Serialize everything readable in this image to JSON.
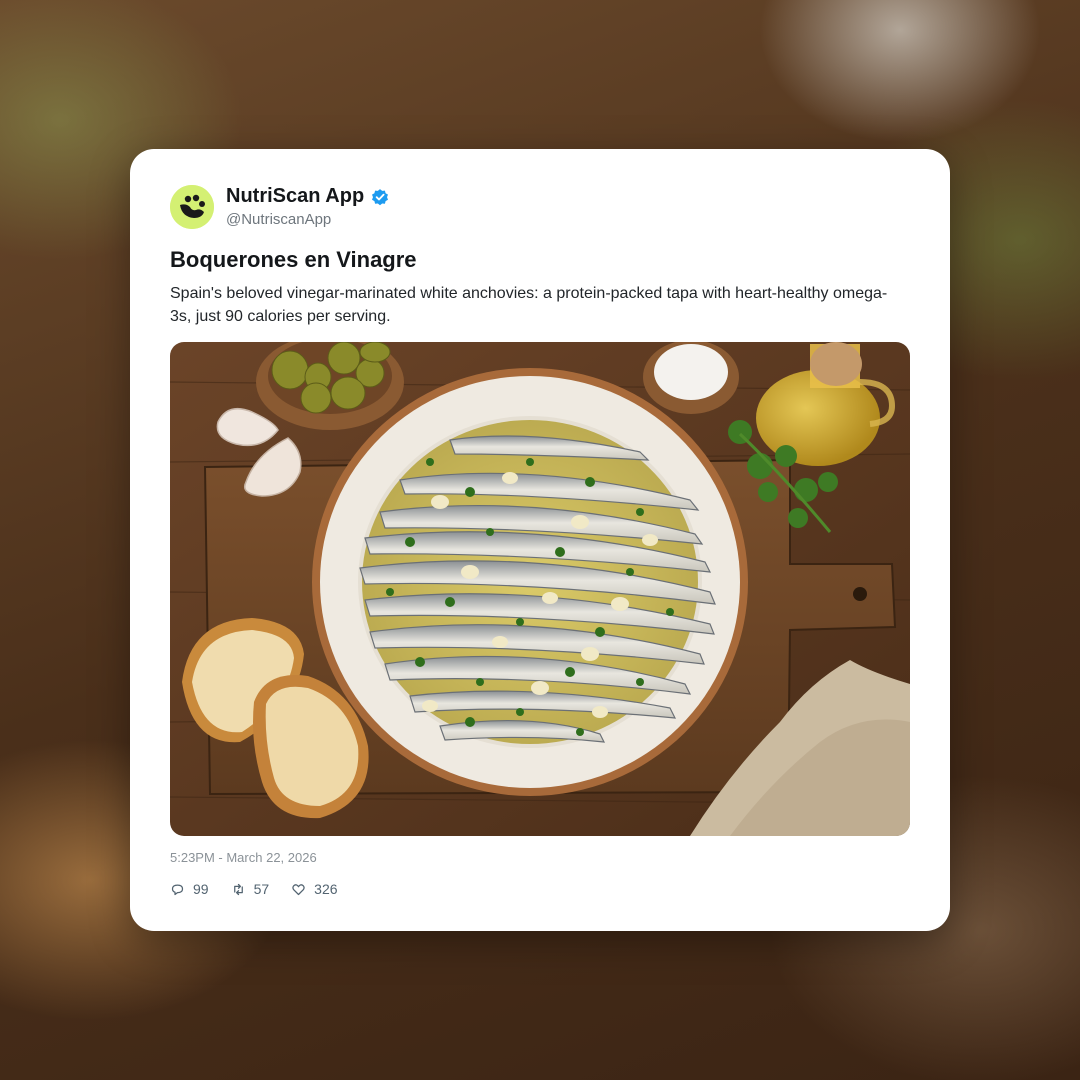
{
  "post": {
    "author": {
      "display_name": "NutriScan App",
      "handle": "@NutriscanApp",
      "verified": true,
      "avatar_icon": "nutriscan-logo-icon",
      "avatar_color": "#d4f073"
    },
    "title": "Boquerones en Vinagre",
    "description": "Spain's beloved vinegar-marinated white anchovies: a protein-packed tapa with heart-healthy omega-3s, just 90 calories per serving.",
    "image": {
      "subject": "plate of white anchovies with garlic, parsley and olive oil on wooden board"
    },
    "timestamp": "5:23PM - March 22, 2026",
    "stats": {
      "replies": "99",
      "reposts": "57",
      "likes": "326"
    },
    "icons": {
      "verified": "verified-badge-icon",
      "reply": "reply-icon",
      "repost": "repost-icon",
      "like": "heart-icon"
    },
    "colors": {
      "verified_badge": "#1d9bf0",
      "card_background": "#ffffff"
    }
  }
}
